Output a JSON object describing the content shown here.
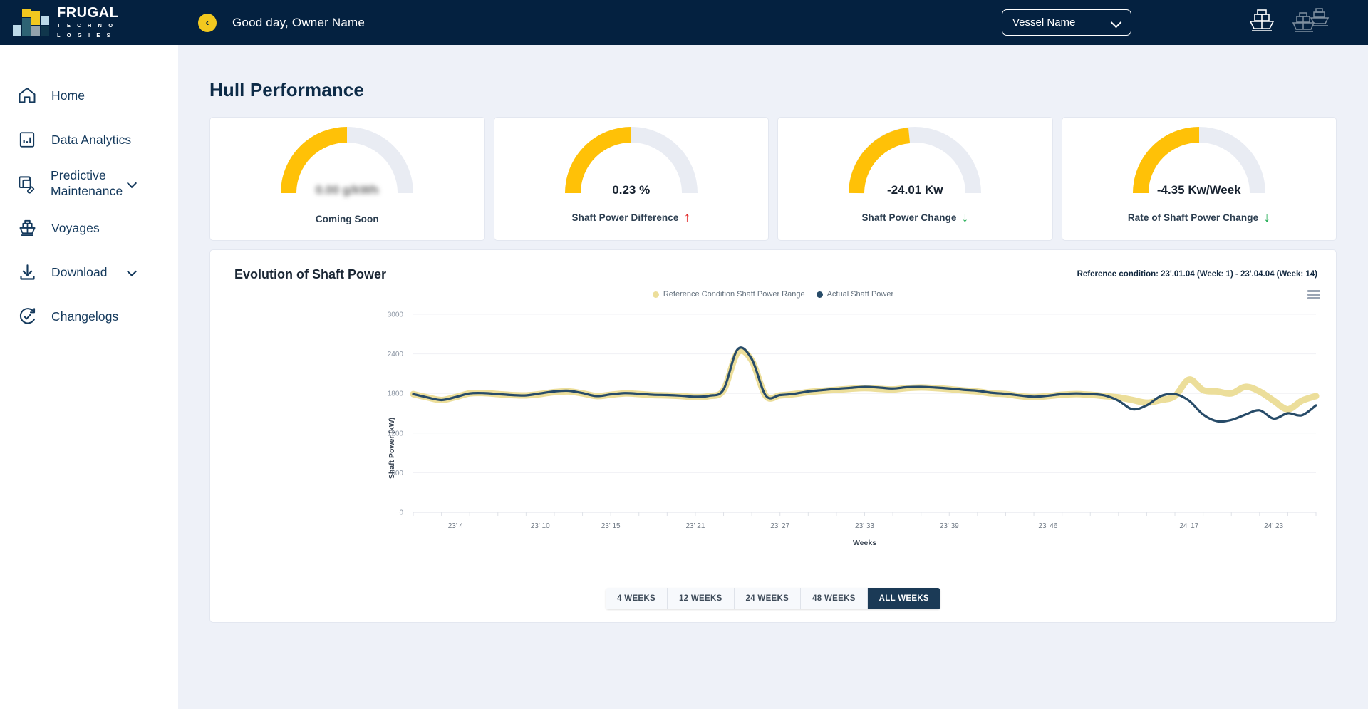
{
  "brand": {
    "name": "FRUGAL",
    "line1": "T E C H N O",
    "line2": "L O G I E S"
  },
  "topbar": {
    "back_icon": "chevron-left-icon",
    "greeting": "Good day, Owner Name",
    "vessel_selected": "Vessel Name",
    "single_ship_icon": "single-ship-icon",
    "multi_ship_icon": "multi-ship-icon"
  },
  "sidebar": {
    "items": [
      {
        "label": "Home",
        "icon": "home-icon",
        "expandable": false
      },
      {
        "label": "Data Analytics",
        "icon": "chart-bar-icon",
        "expandable": false
      },
      {
        "label": "Predictive Maintenance",
        "icon": "wrench-layers-icon",
        "expandable": true
      },
      {
        "label": "Voyages",
        "icon": "ship-icon",
        "expandable": false
      },
      {
        "label": "Download",
        "icon": "download-icon",
        "expandable": true
      },
      {
        "label": "Changelogs",
        "icon": "refresh-check-icon",
        "expandable": false
      }
    ]
  },
  "page": {
    "title": "Hull Performance"
  },
  "kpis": [
    {
      "value": "0.00 g/kWh",
      "label": "Coming Soon",
      "blurred": true,
      "arrow": "",
      "arrow_color": "",
      "gauge_fraction": 0.5
    },
    {
      "value": "0.23 %",
      "label": "Shaft Power Difference",
      "blurred": false,
      "arrow": "↑",
      "arrow_color": "#e02020",
      "gauge_fraction": 0.5
    },
    {
      "value": "-24.01 Kw",
      "label": "Shaft Power Change",
      "blurred": false,
      "arrow": "↓",
      "arrow_color": "#17a84b",
      "gauge_fraction": 0.47
    },
    {
      "value": "-4.35 Kw/Week",
      "label": "Rate of Shaft Power Change",
      "blurred": false,
      "arrow": "↓",
      "arrow_color": "#17a84b",
      "gauge_fraction": 0.5
    }
  ],
  "chart_panel": {
    "title": "Evolution of Shaft Power",
    "reference_condition": "Reference condition: 23'.01.04 (Week: 1) - 23'.04.04 (Week: 14)",
    "menu_icon": "hamburger-menu-icon",
    "range_buttons": [
      {
        "label": "4 WEEKS",
        "active": false
      },
      {
        "label": "12 WEEKS",
        "active": false
      },
      {
        "label": "24 WEEKS",
        "active": false
      },
      {
        "label": "48 WEEKS",
        "active": false
      },
      {
        "label": "ALL WEEKS",
        "active": true
      }
    ]
  },
  "colors": {
    "navy": "#042140",
    "accent_yellow": "#FFC107",
    "reference_band": "#ECDE9A",
    "actual_line": "#274B68",
    "gauge_track": "#E9ECF3",
    "page_bg": "#EEF1F8"
  },
  "chart_data": {
    "type": "line",
    "title": "Evolution of Shaft Power",
    "xlabel": "Weeks",
    "ylabel": "Shaft Power (kW)",
    "ylim": [
      0,
      3000
    ],
    "yticks": [
      0,
      600,
      1200,
      1800,
      2400,
      3000
    ],
    "grid": true,
    "legend_position": "top-center",
    "xtick_labels": [
      "23' 4",
      "23' 10",
      "23' 15",
      "23' 21",
      "23' 27",
      "23' 33",
      "23' 39",
      "23' 46",
      "24' 17",
      "24' 23"
    ],
    "xtick_positions": [
      4,
      10,
      15,
      21,
      27,
      33,
      39,
      46,
      56,
      62
    ],
    "x": [
      1,
      2,
      3,
      4,
      5,
      6,
      7,
      8,
      9,
      10,
      11,
      12,
      13,
      14,
      15,
      16,
      17,
      18,
      19,
      20,
      21,
      22,
      23,
      24,
      25,
      26,
      27,
      28,
      29,
      30,
      31,
      32,
      33,
      34,
      35,
      36,
      37,
      38,
      39,
      40,
      41,
      42,
      43,
      44,
      45,
      46,
      47,
      48,
      49,
      50,
      51,
      52,
      53,
      54,
      55,
      56,
      57,
      58,
      59,
      60,
      61,
      62,
      63,
      64,
      65
    ],
    "series": [
      {
        "name": "Reference Condition Shaft Power Range",
        "color": "#ECDE9A",
        "style": "band",
        "values": [
          1790,
          1740,
          1700,
          1745,
          1800,
          1805,
          1790,
          1775,
          1770,
          1790,
          1820,
          1830,
          1800,
          1760,
          1780,
          1800,
          1790,
          1775,
          1770,
          1760,
          1745,
          1760,
          1850,
          2420,
          2300,
          1760,
          1770,
          1790,
          1820,
          1840,
          1855,
          1870,
          1880,
          1870,
          1860,
          1880,
          1890,
          1880,
          1865,
          1845,
          1830,
          1800,
          1790,
          1760,
          1745,
          1760,
          1780,
          1790,
          1780,
          1760,
          1740,
          1700,
          1660,
          1700,
          1760,
          2010,
          1850,
          1830,
          1800,
          1900,
          1830,
          1690,
          1560,
          1690,
          1760
        ]
      },
      {
        "name": "Actual Shaft Power",
        "color": "#274B68",
        "style": "line",
        "values": [
          1790,
          1740,
          1700,
          1745,
          1800,
          1805,
          1790,
          1775,
          1770,
          1800,
          1830,
          1840,
          1805,
          1760,
          1785,
          1805,
          1795,
          1780,
          1775,
          1765,
          1750,
          1765,
          1860,
          2470,
          2320,
          1765,
          1775,
          1795,
          1830,
          1850,
          1870,
          1885,
          1900,
          1890,
          1875,
          1895,
          1900,
          1890,
          1875,
          1855,
          1840,
          1810,
          1795,
          1770,
          1750,
          1765,
          1790,
          1800,
          1790,
          1770,
          1690,
          1560,
          1620,
          1760,
          1790,
          1690,
          1480,
          1380,
          1400,
          1480,
          1545,
          1420,
          1500,
          1470,
          1620
        ]
      }
    ]
  }
}
